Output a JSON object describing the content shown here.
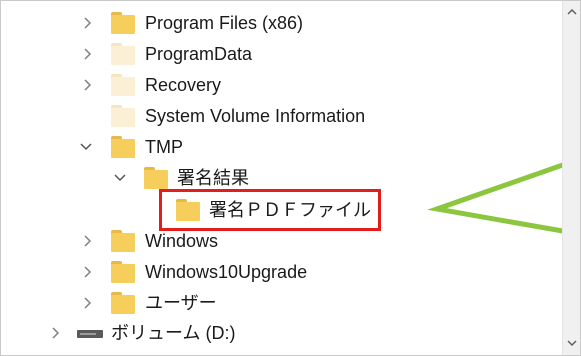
{
  "tree": {
    "items": [
      {
        "label": "Program Files (x86)",
        "chevron": "right",
        "folder": "normal"
      },
      {
        "label": "ProgramData",
        "chevron": "right",
        "folder": "pale"
      },
      {
        "label": "Recovery",
        "chevron": "right",
        "folder": "pale"
      },
      {
        "label": "System Volume Information",
        "chevron": "",
        "folder": "pale"
      },
      {
        "label": "TMP",
        "chevron": "down",
        "folder": "normal"
      },
      {
        "label": "署名結果",
        "chevron": "down",
        "folder": "normal"
      },
      {
        "label": "署名ＰＤＦファイル",
        "chevron": "",
        "folder": "normal",
        "selected": true
      },
      {
        "label": "Windows",
        "chevron": "right",
        "folder": "normal"
      },
      {
        "label": "Windows10Upgrade",
        "chevron": "right",
        "folder": "normal"
      },
      {
        "label": "ユーザー",
        "chevron": "right",
        "folder": "normal"
      },
      {
        "label": "ボリューム (D:)",
        "chevron": "right",
        "folder": "drive"
      }
    ]
  },
  "colors": {
    "folder": "#f6ce5b",
    "folder_pale": "#fbf0d6",
    "highlight": "#e31c1c",
    "callout_border": "#8cc63f"
  },
  "scrollbar": {
    "up_icon": "chevron-up-icon",
    "down_icon": "chevron-down-icon"
  }
}
